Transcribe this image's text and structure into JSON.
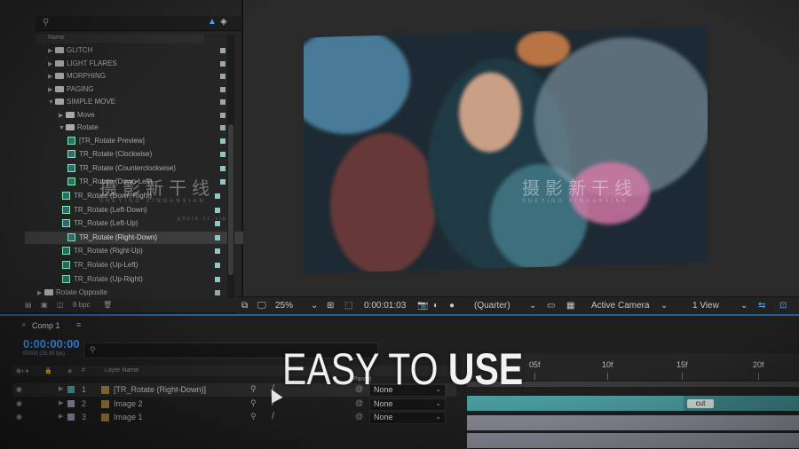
{
  "project_panel": {
    "column_header": "Name",
    "items": [
      {
        "label": "GLITCH",
        "type": "folder",
        "expanded": false
      },
      {
        "label": "LIGHT FLARES",
        "type": "folder",
        "expanded": false
      },
      {
        "label": "MORPHING",
        "type": "folder",
        "expanded": false
      },
      {
        "label": "PAGING",
        "type": "folder",
        "expanded": false
      },
      {
        "label": "SIMPLE MOVE",
        "type": "folder",
        "expanded": true
      },
      {
        "label": "Move",
        "type": "folder",
        "expanded": false
      },
      {
        "label": "Rotate",
        "type": "folder",
        "expanded": true
      },
      {
        "label": "[TR_Rotate Preview]",
        "type": "comp"
      },
      {
        "label": "TR_Rotate (Clockwise)",
        "type": "comp"
      },
      {
        "label": "TR_Rotate (Counterclockwise)",
        "type": "comp"
      },
      {
        "label": "TR_Rotate (Down-Left)",
        "type": "comp"
      },
      {
        "label": "TR_Rotate (Down-Right)",
        "type": "comp"
      },
      {
        "label": "TR_Rotate (Left-Down)",
        "type": "comp"
      },
      {
        "label": "TR_Rotate (Left-Up)",
        "type": "comp"
      },
      {
        "label": "TR_Rotate (Right-Down)",
        "type": "comp",
        "selected": true
      },
      {
        "label": "TR_Rotate (Right-Up)",
        "type": "comp"
      },
      {
        "label": "TR_Rotate (Up-Left)",
        "type": "comp"
      },
      {
        "label": "TR_Rotate (Up-Right)",
        "type": "comp"
      },
      {
        "label": "Rotate Opposite",
        "type": "folder",
        "expanded": false
      }
    ],
    "footer_bpc": "8 bpc"
  },
  "viewer_toolbar": {
    "zoom": "25%",
    "timecode": "0:00:01:03",
    "resolution": "(Quarter)",
    "camera": "Active Camera",
    "views": "1 View"
  },
  "watermark": {
    "text1": "摄影新干线",
    "sub1": "SHEYING XINGANXIAN",
    "text2": "摄影新干线",
    "sub2": "SHEYING XINGANXIAN",
    "url": "photo.sx.vip"
  },
  "timeline": {
    "tab_name": "Comp 1",
    "current_time": "0:00:00:00",
    "fps_note": "00000 (25.00 fps)",
    "layer_name_header": "Layer Name",
    "parent_header": "Parent",
    "layers": [
      {
        "num": "1",
        "name": "[TR_Rotate (Right-Down)]",
        "label_color": "#4fb3b0",
        "parent": "None"
      },
      {
        "num": "2",
        "name": "Image 2",
        "label_color": "#a9a9c8",
        "parent": "None"
      },
      {
        "num": "3",
        "name": "Image 1",
        "label_color": "#a9a9c8",
        "parent": "None"
      }
    ],
    "ruler_labels": [
      "05f",
      "10f",
      "15f",
      "20f"
    ],
    "marker": "cut"
  },
  "headline": {
    "part1": "EASY ",
    "part2": "TO ",
    "part3": "USE"
  },
  "colors": {
    "accent_blue": "#3a9bff",
    "teal_track": "#4c9fa3",
    "gray_track": "#8d8d99"
  }
}
